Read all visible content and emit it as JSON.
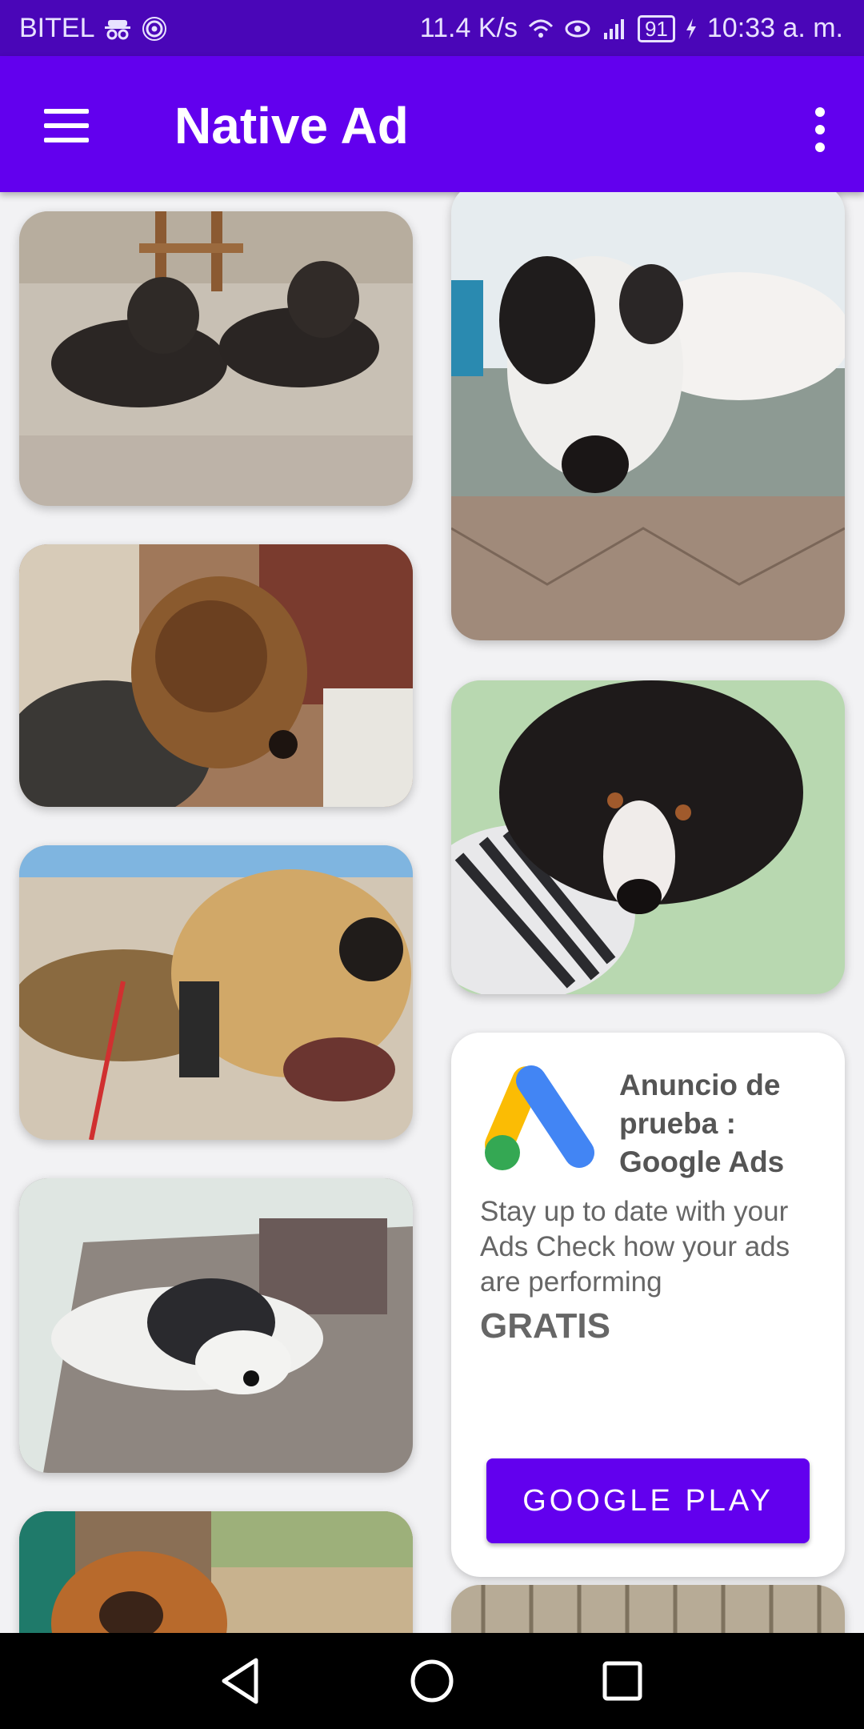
{
  "status_bar": {
    "carrier": "BITEL",
    "speed": "11.4 K/s",
    "battery": "91",
    "time": "10:33 a. m.",
    "icons": [
      "incognito-icon",
      "hotspot-icon",
      "wifi-icon",
      "eye-icon",
      "signal-icon",
      "charging-icon"
    ]
  },
  "app_bar": {
    "title": "Native Ad",
    "menu_icon": "hamburger-menu-icon",
    "overflow_icon": "more-vert-icon",
    "color": "#6200ee"
  },
  "photos": [
    {
      "subject": "two black schnauzers on tile floor"
    },
    {
      "subject": "white and black dog on bed"
    },
    {
      "subject": "airedale terrier by window"
    },
    {
      "subject": "bernese puppy on green pillow"
    },
    {
      "subject": "hound dog on beach"
    },
    {
      "subject": "husky under white chair"
    },
    {
      "subject": "pekingese dog on porch"
    },
    {
      "subject": "dog near wooden fence"
    }
  ],
  "ad": {
    "title": "Anuncio de prueba : Google Ads",
    "body": "Stay up to date with your Ads Check how your ads are performing",
    "price": "GRATIS",
    "cta": "GOOGLE PLAY",
    "logo_icon": "google-ads-logo-icon"
  },
  "nav_bar": {
    "back_icon": "back-triangle-icon",
    "home_icon": "home-circle-icon",
    "recents_icon": "recents-square-icon"
  }
}
